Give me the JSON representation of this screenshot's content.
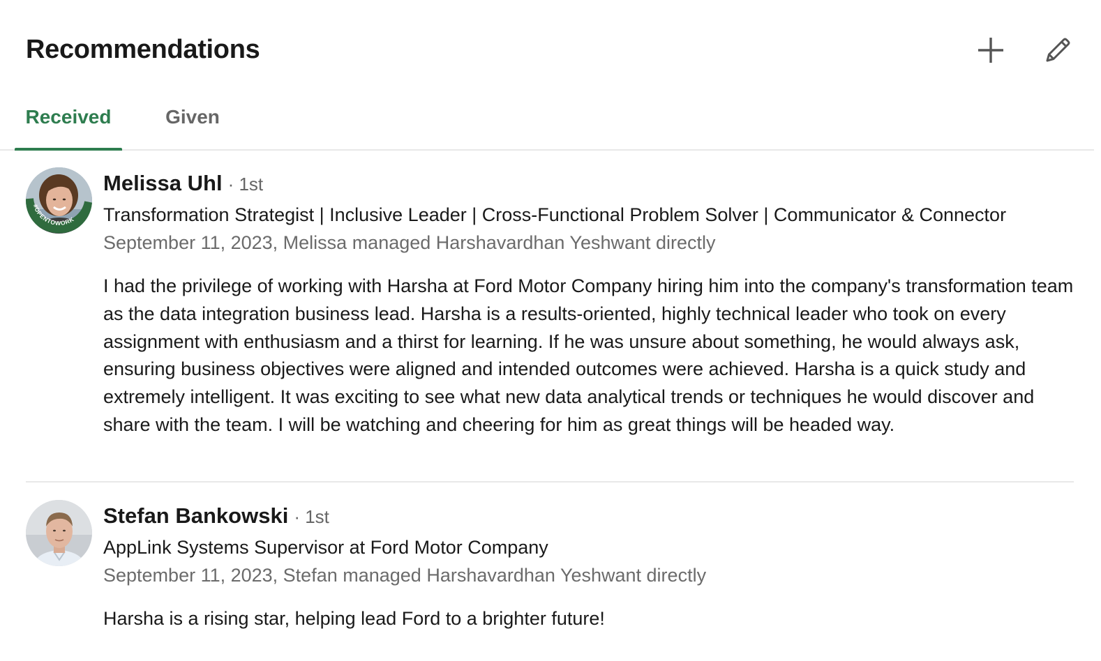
{
  "section": {
    "title": "Recommendations",
    "add_icon": "plus-icon",
    "edit_icon": "pencil-icon"
  },
  "tabs": [
    {
      "label": "Received",
      "active": true
    },
    {
      "label": "Given",
      "active": false
    }
  ],
  "colors": {
    "accent_green": "#2e7d4f",
    "muted_text": "#666666",
    "divider": "#e8e8e8"
  },
  "recommendations": [
    {
      "name": "Melissa Uhl",
      "degree": "· 1st",
      "headline": "Transformation Strategist | Inclusive Leader | Cross-Functional Problem Solver | Communicator & Connector",
      "meta": "September 11, 2023, Melissa managed Harshavardhan Yeshwant directly",
      "text": "I had the privilege of working with Harsha at Ford Motor Company hiring him into the company's transformation team as the data integration business lead. Harsha is a results-oriented, highly technical leader who took on every assignment with enthusiasm and a thirst for learning. If he was unsure about something, he would always ask, ensuring business objectives were aligned and intended outcomes were achieved. Harsha is a quick study and extremely intelligent. It was exciting to see what new data analytical trends or techniques he would discover and share with the team. I will be watching and cheering for him as great things will be headed way.",
      "avatar_badge": "#OPENTOWORK"
    },
    {
      "name": "Stefan Bankowski",
      "degree": "· 1st",
      "headline": "AppLink Systems Supervisor at Ford Motor Company",
      "meta": "September 11, 2023, Stefan managed Harshavardhan Yeshwant directly",
      "text": "Harsha is a rising star, helping lead Ford to a brighter future!"
    }
  ]
}
